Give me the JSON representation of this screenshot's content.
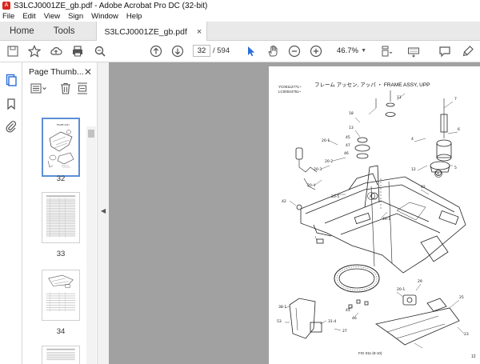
{
  "window": {
    "title": "S3LCJ0001ZE_gb.pdf - Adobe Acrobat Pro DC (32-bit)"
  },
  "menu": [
    "File",
    "Edit",
    "View",
    "Sign",
    "Window",
    "Help"
  ],
  "tabs": {
    "home": "Home",
    "tools": "Tools",
    "document": "S3LCJ0001ZE_gb.pdf",
    "close": "×"
  },
  "toolbar": {
    "current_page": "32",
    "total_pages": "/ 594",
    "zoom": "46.7%"
  },
  "thumb_panel": {
    "title": "Page Thumb...",
    "close": "✕",
    "pages": [
      "32",
      "33",
      "34"
    ]
  },
  "page": {
    "title": "フレーム アッセン, アッパ ・ FRAME ASSY, UPP",
    "code_line1": "YC00112771~",
    "code_line2": "LC00044751~",
    "figure_ref": "FIG 011-(9-10)",
    "page_number": "12"
  },
  "colors": {
    "accent": "#2a6ed8",
    "viewer_bg": "#a1a1a1",
    "acrobat_red": "#d7261e"
  }
}
